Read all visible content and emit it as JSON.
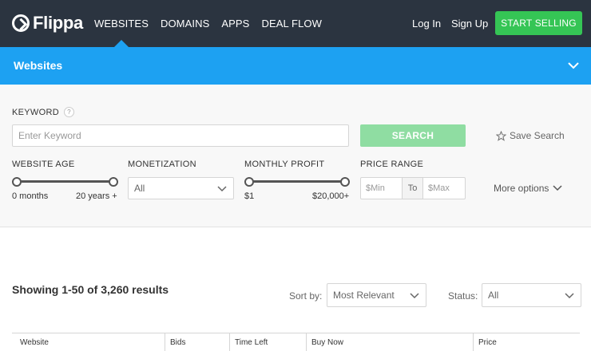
{
  "nav": {
    "logo_text": "Flippa",
    "items": [
      "WEBSITES",
      "DOMAINS",
      "APPS",
      "DEAL FLOW"
    ],
    "login": "Log In",
    "signup": "Sign Up",
    "cta": "START SELLING"
  },
  "category": {
    "title": "Websites"
  },
  "filters": {
    "keyword_label": "KEYWORD",
    "help_symbol": "?",
    "keyword_placeholder": "Enter Keyword",
    "search_button": "SEARCH",
    "save_search": "Save Search",
    "website_age": {
      "label": "WEBSITE AGE",
      "min": "0 months",
      "max": "20 years +"
    },
    "monetization": {
      "label": "MONETIZATION",
      "selected": "All"
    },
    "monthly_profit": {
      "label": "MONTHLY PROFIT",
      "min": "$1",
      "max": "$20,000+"
    },
    "price_range": {
      "label": "PRICE RANGE",
      "min_placeholder": "$Min",
      "to": "To",
      "max_placeholder": "$Max"
    },
    "more_options": "More options"
  },
  "results": {
    "summary": "Showing 1-50 of 3,260 results",
    "sort_label": "Sort by:",
    "sort_selected": "Most Relevant",
    "status_label": "Status:",
    "status_selected": "All",
    "columns": [
      "Website",
      "Bids",
      "Time Left",
      "Buy Now",
      "Price"
    ]
  },
  "colors": {
    "nav_bg": "#2b3440",
    "accent_blue": "#1da1f2",
    "cta_green": "#35c555",
    "search_green": "#8fdda2"
  }
}
